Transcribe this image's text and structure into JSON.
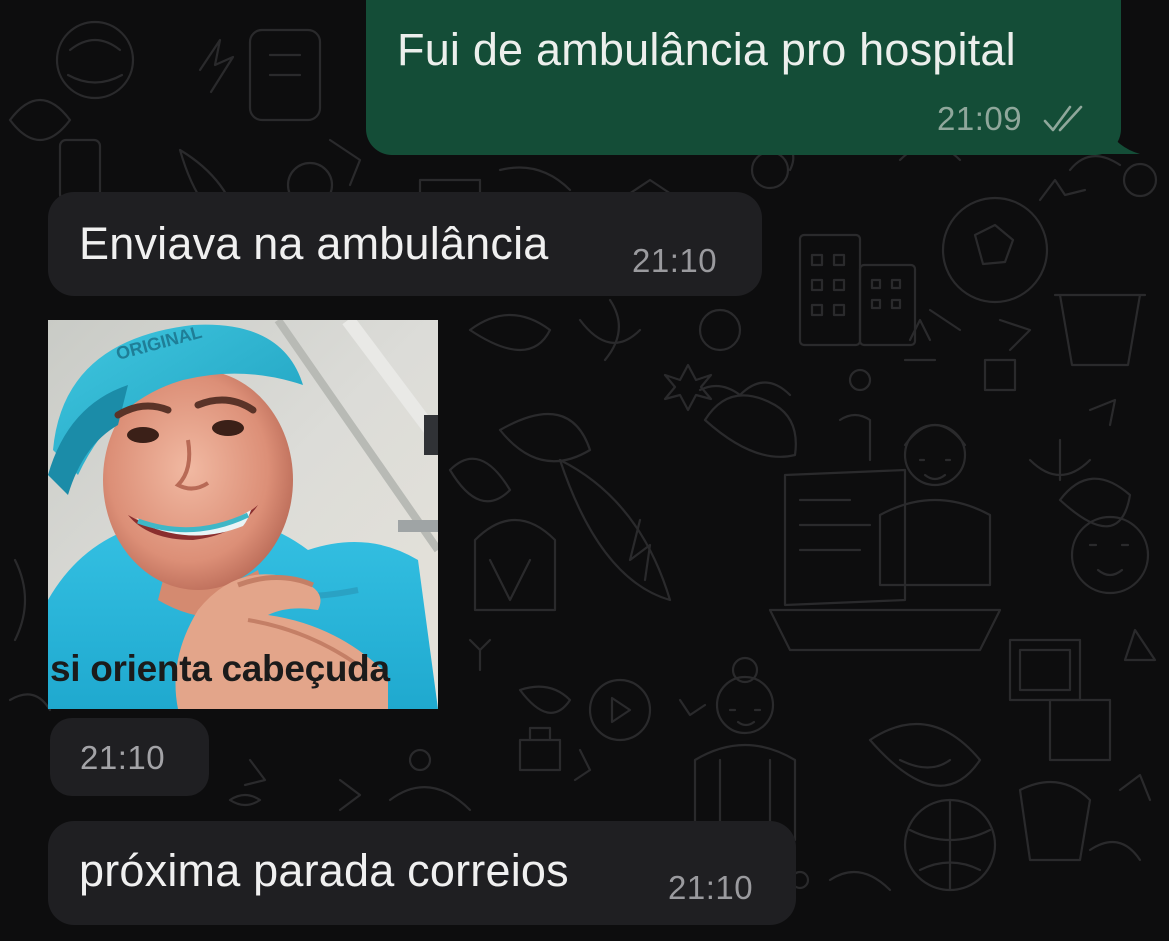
{
  "messages": [
    {
      "direction": "outgoing",
      "text": "Fui de ambulância pro hospital",
      "time": "21:09",
      "status_icon": "double-check-icon"
    },
    {
      "direction": "incoming",
      "text": "Enviava na ambulância",
      "time": "21:10"
    },
    {
      "direction": "incoming",
      "type": "sticker",
      "sticker_caption": "si orienta cabeçuda",
      "time": "21:10"
    },
    {
      "direction": "incoming",
      "text": "próxima parada correios",
      "time": "21:10"
    }
  ],
  "colors": {
    "background": "#0d0d0e",
    "outgoing_bubble": "#144d37",
    "incoming_bubble": "#1f1f22",
    "message_text": "#f0f0f0",
    "timestamp": "#9a9a9e",
    "sticker_cyan": "#3fc6df"
  }
}
